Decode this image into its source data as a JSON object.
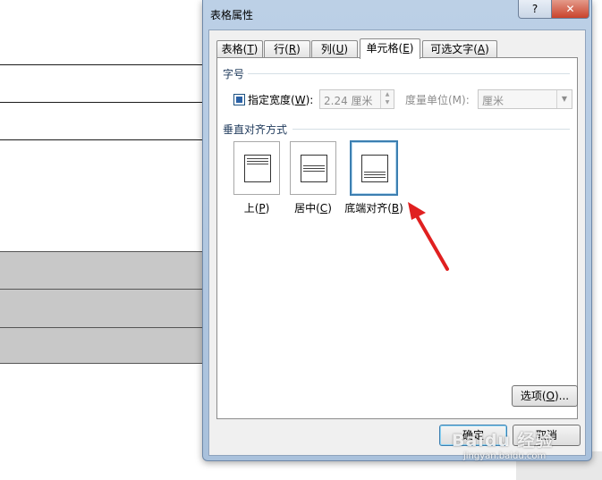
{
  "dialog": {
    "title": "表格属性",
    "help_glyph": "?",
    "close_glyph": "✕"
  },
  "tabs": [
    {
      "label": "表格(",
      "key": "T",
      "end": ")"
    },
    {
      "label": "行(",
      "key": "R",
      "end": ")"
    },
    {
      "label": "列(",
      "key": "U",
      "end": ")"
    },
    {
      "label": "单元格(",
      "key": "E",
      "end": ")",
      "active": true
    },
    {
      "label": "可选文字(",
      "key": "A",
      "end": ")"
    }
  ],
  "size_group": {
    "label": "字号",
    "checkbox_label_pre": "指定宽度(",
    "checkbox_label_key": "W",
    "checkbox_label_post": "):",
    "checked": true,
    "width_value": "2.24 厘米",
    "unit_label": "度量单位(M):",
    "unit_value": "厘米"
  },
  "valign_group": {
    "label": "垂直对齐方式",
    "options": [
      {
        "label": "上(",
        "key": "P",
        "end": ")"
      },
      {
        "label": "居中(",
        "key": "C",
        "end": ")"
      },
      {
        "label": "底端对齐(",
        "key": "B",
        "end": ")",
        "selected": true
      }
    ]
  },
  "buttons": {
    "options_pre": "选项(",
    "options_key": "O",
    "options_post": ")...",
    "ok": "确定",
    "cancel": "取消"
  },
  "watermark": {
    "text": "Baidu 经验",
    "sub": "jingyan.baidu.com"
  },
  "colors": {
    "arrow": "#e02020",
    "accent": "#3c7fb1"
  }
}
